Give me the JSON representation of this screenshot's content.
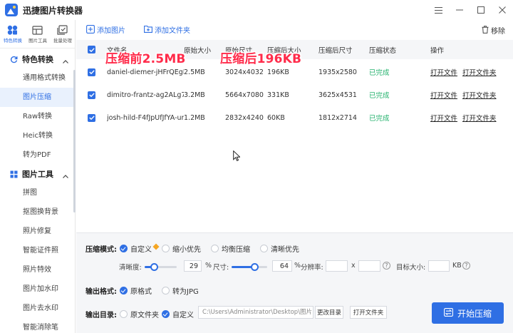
{
  "app": {
    "title": "迅捷图片转换器"
  },
  "tool_tabs": [
    {
      "label": "特色转换",
      "icon": "convert-icon",
      "active": true
    },
    {
      "label": "图片工具",
      "icon": "tools-icon",
      "active": false
    },
    {
      "label": "批量处理",
      "icon": "batch-icon",
      "active": false
    }
  ],
  "nav": {
    "group1": {
      "label": "特色转换",
      "items": [
        "通用格式转换",
        "图片压缩",
        "Raw转换",
        "Heic转换",
        "转为PDF"
      ]
    },
    "group2": {
      "label": "图片工具",
      "items": [
        "拼图",
        "抠图换背景",
        "照片修复",
        "智能证件照",
        "照片特效",
        "图片加水印",
        "图片去水印",
        "智能消除笔"
      ]
    },
    "active_item": "图片压缩"
  },
  "toolbar": {
    "add_image": "添加图片",
    "add_folder": "添加文件夹",
    "remove": "移除"
  },
  "table": {
    "headers": {
      "filename": "文件名",
      "orig_size": "原始大小",
      "orig_dim": "原始尺寸",
      "comp_size": "压缩后大小",
      "comp_dim": "压缩后尺寸",
      "status": "压缩状态",
      "action": "操作"
    },
    "rows": [
      {
        "filename": "daniel-diemer-jHFrQEgE...",
        "orig_size": "2.5MB",
        "orig_dim": "3024x4032",
        "comp_size": "196KB",
        "comp_dim": "1935x2580",
        "status": "已完成",
        "open_file": "打开文件",
        "open_folder": "打开文件夹"
      },
      {
        "filename": "dimitro-frantz-ag2ALg7y...",
        "orig_size": "3.2MB",
        "orig_dim": "5664x7080",
        "comp_size": "331KB",
        "comp_dim": "3625x4531",
        "status": "已完成",
        "open_file": "打开文件",
        "open_folder": "打开文件夹"
      },
      {
        "filename": "josh-hild-F4fJpUfJfYA-un...",
        "orig_size": "1.2MB",
        "orig_dim": "2832x4240",
        "comp_size": "60KB",
        "comp_dim": "1812x2714",
        "status": "已完成",
        "open_file": "打开文件",
        "open_folder": "打开文件夹"
      }
    ]
  },
  "overlay": {
    "before": "压缩前2.5MB",
    "after": "压缩后196KB"
  },
  "settings": {
    "mode_label": "压缩模式:",
    "modes": [
      "自定义",
      "缩小优先",
      "均衡压缩",
      "清晰优先"
    ],
    "clarity_label": "清晰度:",
    "clarity_value": "29",
    "clarity_percent": 29,
    "size_label": "尺寸:",
    "size_value": "64",
    "size_percent": 64,
    "percent_unit": "%",
    "resolution_label": "分辨率:",
    "x_label": "x",
    "target_label": "目标大小:",
    "target_unit": "KB",
    "format_label": "输出格式:",
    "formats": [
      "原格式",
      "转为JPG"
    ],
    "dir_label": "输出目录:",
    "dirs": [
      "原文件夹",
      "自定义"
    ],
    "path": "C:\\Users\\Administrator\\Desktop\\图片",
    "change_dir": "更改目录",
    "open_folder": "打开文件夹",
    "start": "开始压缩"
  },
  "colors": {
    "accent": "#2f6fe4",
    "done": "#23b26d",
    "overlay": "#ff2b4a"
  }
}
